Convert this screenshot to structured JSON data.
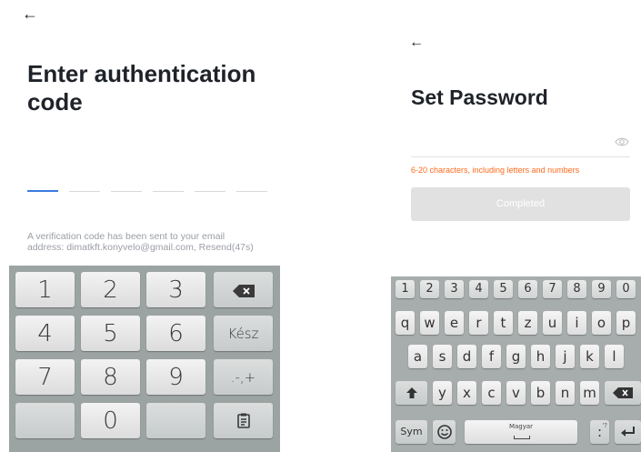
{
  "auth_screen": {
    "back_icon": "arrow-left",
    "title": "Enter authentication code",
    "code_slots": 6,
    "info_line1": "A verification code has been sent to your email",
    "info_line2": "address: dimatkft.konyvelo@gmail.com, Resend(47s)",
    "keypad": {
      "rows": [
        [
          "1",
          "2",
          "3",
          "backspace-icon"
        ],
        [
          "4",
          "5",
          "6",
          "Kész"
        ],
        [
          "7",
          "8",
          "9",
          ".-,+"
        ],
        [
          "",
          "0",
          "",
          "clipboard-icon"
        ]
      ]
    }
  },
  "password_screen": {
    "back_icon": "arrow-left",
    "title": "Set Password",
    "eye_icon": "eye-icon",
    "hint": "6-20 characters, including letters and numbers",
    "hint_color": "#ff6a1a",
    "completed_label": "Completed",
    "keyboard": {
      "numbers": [
        "1",
        "2",
        "3",
        "4",
        "5",
        "6",
        "7",
        "8",
        "9",
        "0"
      ],
      "row1": [
        "q",
        "w",
        "e",
        "r",
        "t",
        "z",
        "u",
        "i",
        "o",
        "p"
      ],
      "row2": [
        "a",
        "s",
        "d",
        "f",
        "g",
        "h",
        "j",
        "k",
        "l"
      ],
      "row3": [
        "y",
        "x",
        "c",
        "v",
        "b",
        "n",
        "m"
      ],
      "sym_label": "Sym",
      "space_label": "Magyar",
      "punct_label": ":",
      "punct_sup": "'?"
    }
  },
  "colors": {
    "accent": "#3a7be0",
    "keyboard_bg": "#9ca3a3"
  }
}
